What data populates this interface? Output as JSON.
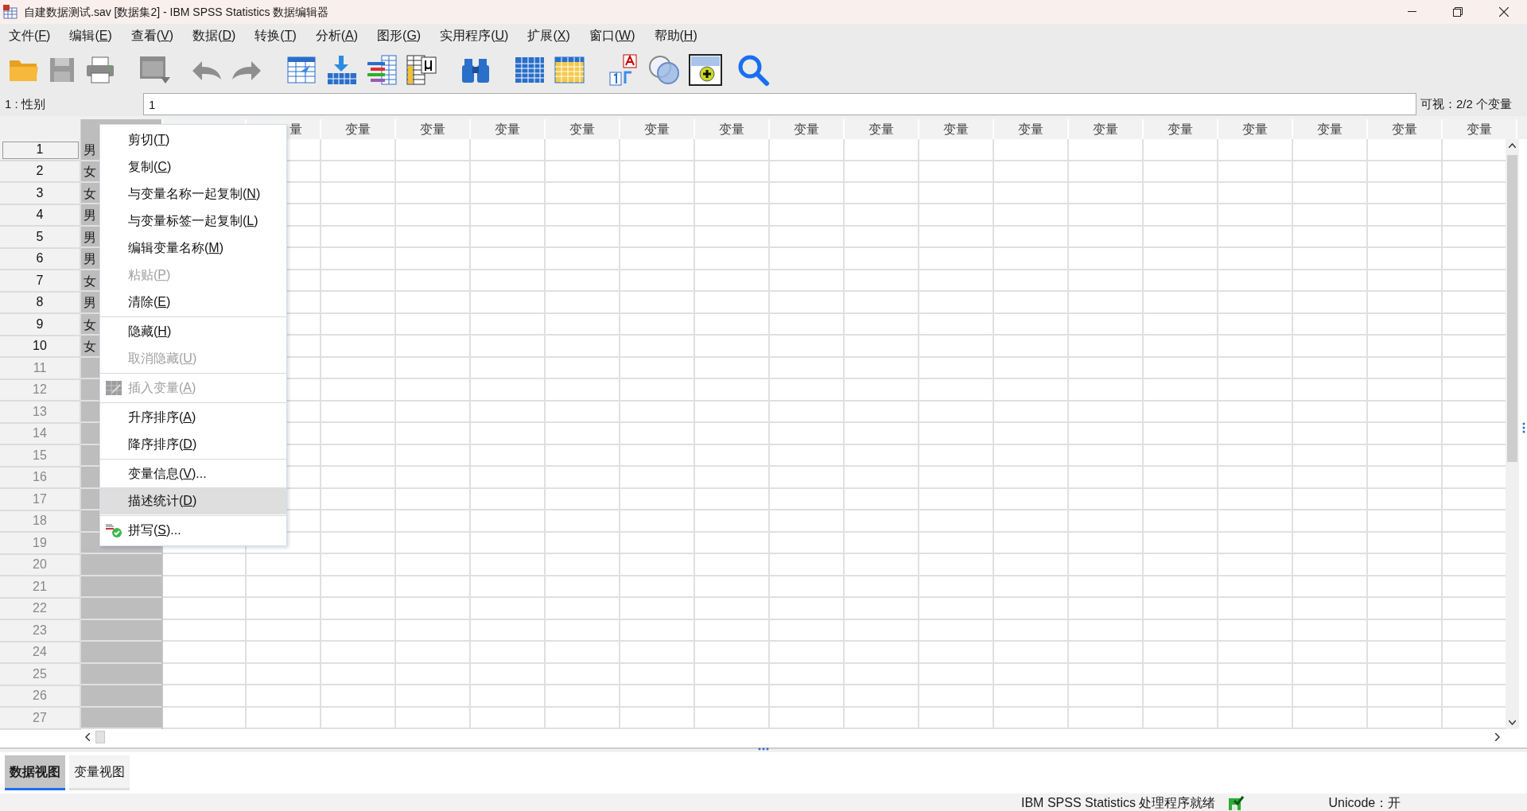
{
  "window": {
    "title": "自建数据测试.sav [数据集2] - IBM SPSS Statistics 数据编辑器"
  },
  "menu_bar": [
    {
      "before": "文件(",
      "key": "F",
      "after": ")"
    },
    {
      "before": "编辑(",
      "key": "E",
      "after": ")"
    },
    {
      "before": "查看(",
      "key": "V",
      "after": ")"
    },
    {
      "before": "数据(",
      "key": "D",
      "after": ")"
    },
    {
      "before": "转换(",
      "key": "T",
      "after": ")"
    },
    {
      "before": "分析(",
      "key": "A",
      "after": ")"
    },
    {
      "before": "图形(",
      "key": "G",
      "after": ")"
    },
    {
      "before": "实用程序(",
      "key": "U",
      "after": ")"
    },
    {
      "before": "扩展(",
      "key": "X",
      "after": ")"
    },
    {
      "before": "窗口(",
      "key": "W",
      "after": ")"
    },
    {
      "before": "帮助(",
      "key": "H",
      "after": ")"
    }
  ],
  "cell_editor": {
    "cell_label": "1 : 性别",
    "value": "1",
    "visible_count": "可视：2/2 个变量"
  },
  "table": {
    "columns": [
      {
        "selected": true
      },
      {
        "selected": false
      },
      {
        "header": "量",
        "selected": false
      },
      {
        "header": "变量",
        "selected": false
      },
      {
        "header": "变量",
        "selected": false
      },
      {
        "header": "变量",
        "selected": false
      },
      {
        "header": "变量",
        "selected": false
      },
      {
        "header": "变量",
        "selected": false
      },
      {
        "header": "变量",
        "selected": false
      },
      {
        "header": "变量",
        "selected": false
      },
      {
        "header": "变量",
        "selected": false
      },
      {
        "header": "变量",
        "selected": false
      },
      {
        "header": "变量",
        "selected": false
      },
      {
        "header": "变量",
        "selected": false
      },
      {
        "header": "变量",
        "selected": false
      },
      {
        "header": "变量",
        "selected": false
      },
      {
        "header": "变量",
        "selected": false
      },
      {
        "header": "变量",
        "selected": false
      },
      {
        "header": "变量",
        "selected": false
      }
    ],
    "rows": [
      {
        "number": "1",
        "cells": [
          "男"
        ],
        "selected": true,
        "empty": false
      },
      {
        "number": "2",
        "cells": [
          "女"
        ],
        "selected": false,
        "empty": false
      },
      {
        "number": "3",
        "cells": [
          "女"
        ],
        "selected": false,
        "empty": false
      },
      {
        "number": "4",
        "cells": [
          "男"
        ],
        "selected": false,
        "empty": false
      },
      {
        "number": "5",
        "cells": [
          "男"
        ],
        "selected": false,
        "empty": false
      },
      {
        "number": "6",
        "cells": [
          "男"
        ],
        "selected": false,
        "empty": false
      },
      {
        "number": "7",
        "cells": [
          "女"
        ],
        "selected": false,
        "empty": false
      },
      {
        "number": "8",
        "cells": [
          "男"
        ],
        "selected": false,
        "empty": false
      },
      {
        "number": "9",
        "cells": [
          "女"
        ],
        "selected": false,
        "empty": false
      },
      {
        "number": "10",
        "cells": [
          "女"
        ],
        "selected": false,
        "empty": false
      },
      {
        "number": "11",
        "selected": false,
        "empty": true
      },
      {
        "number": "12",
        "selected": false,
        "empty": true
      },
      {
        "number": "13",
        "selected": false,
        "empty": true
      },
      {
        "number": "14",
        "selected": false,
        "empty": true
      },
      {
        "number": "15",
        "selected": false,
        "empty": true
      },
      {
        "number": "16",
        "selected": false,
        "empty": true
      },
      {
        "number": "17",
        "selected": false,
        "empty": true
      },
      {
        "number": "18",
        "selected": false,
        "empty": true
      },
      {
        "number": "19",
        "selected": false,
        "empty": true
      },
      {
        "number": "20",
        "selected": false,
        "empty": true
      },
      {
        "number": "21",
        "selected": false,
        "empty": true
      },
      {
        "number": "22",
        "selected": false,
        "empty": true
      },
      {
        "number": "23",
        "selected": false,
        "empty": true
      },
      {
        "number": "24",
        "selected": false,
        "empty": true
      },
      {
        "number": "25",
        "selected": false,
        "empty": true
      },
      {
        "number": "26",
        "selected": false,
        "empty": true
      },
      {
        "number": "27",
        "selected": false,
        "empty": true
      }
    ]
  },
  "context_menu": [
    {
      "before": "剪切(",
      "key": "T",
      "after": ")",
      "disabled": false,
      "selected": false
    },
    {
      "before": "复制(",
      "key": "C",
      "after": ")",
      "disabled": false,
      "selected": false
    },
    {
      "before": "与变量名称一起复制(",
      "key": "N",
      "after": ")",
      "disabled": false,
      "selected": false
    },
    {
      "before": "与变量标签一起复制(",
      "key": "L",
      "after": ")",
      "disabled": false,
      "selected": false
    },
    {
      "before": "编辑变量名称(",
      "key": "M",
      "after": ")",
      "disabled": false,
      "selected": false
    },
    {
      "before": "粘贴(",
      "key": "P",
      "after": ")",
      "disabled": true,
      "selected": false
    },
    {
      "before": "清除(",
      "key": "E",
      "after": ")",
      "disabled": false,
      "selected": false,
      "separator_after": true
    },
    {
      "before": "隐藏(",
      "key": "H",
      "after": ")",
      "disabled": false,
      "selected": false
    },
    {
      "before": "取消隐藏(",
      "key": "U",
      "after": ")",
      "disabled": true,
      "selected": false,
      "separator_after": true
    },
    {
      "before": "插入变量(",
      "key": "A",
      "after": ")",
      "disabled": true,
      "selected": false,
      "kind": "grid",
      "separator_after": true
    },
    {
      "before": "升序排序(",
      "key": "A",
      "after": ")",
      "disabled": false,
      "selected": false
    },
    {
      "before": "降序排序(",
      "key": "D",
      "after": ")",
      "disabled": false,
      "selected": false,
      "separator_after": true
    },
    {
      "before": "变量信息(",
      "key": "V",
      "after": ")...",
      "disabled": false,
      "selected": false
    },
    {
      "before": "描述统计(",
      "key": "D",
      "after": ")",
      "disabled": false,
      "selected": true,
      "separator_after": true
    },
    {
      "before": "拼写(",
      "key": "S",
      "after": ")...",
      "disabled": false,
      "selected": false,
      "kind": "spell"
    }
  ],
  "view_tabs": [
    {
      "label": "数据视图",
      "selected": true
    },
    {
      "label": "变量视图",
      "selected": false
    }
  ],
  "status_bar": {
    "processor": "IBM SPSS Statistics 处理程序就绪",
    "unicode": "Unicode：开"
  }
}
